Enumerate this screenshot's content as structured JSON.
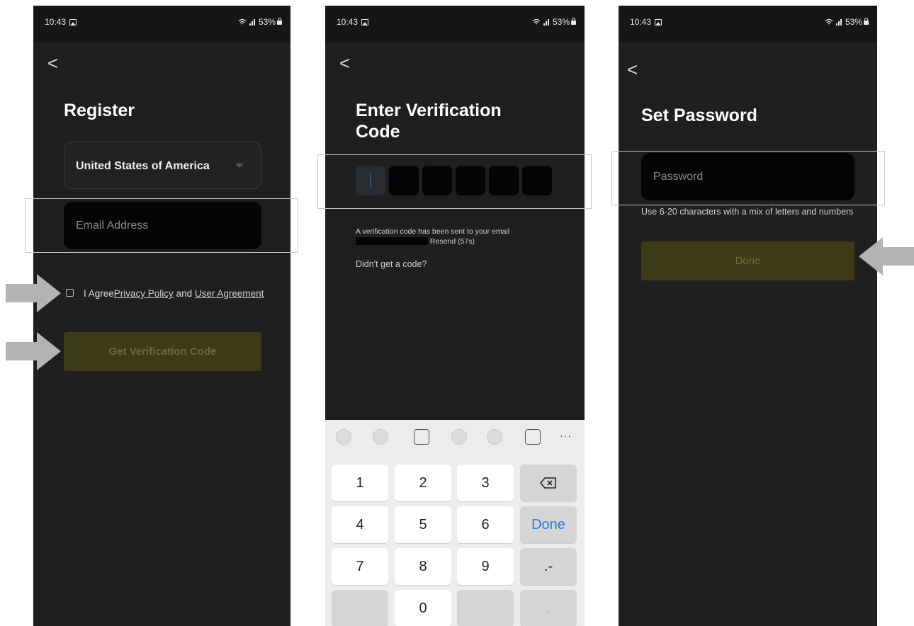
{
  "status": {
    "time": "10:43",
    "battery": "53%"
  },
  "screen1": {
    "back": "<",
    "title": "Register",
    "country": "United States of America",
    "email_placeholder": "Email Address",
    "agree_prefix": "I Agree",
    "privacy_link": "Privacy Policy",
    "agree_and": " and ",
    "user_agreement_link": "User Agreement",
    "button": "Get Verification Code"
  },
  "screen2": {
    "back": "<",
    "title_line1": "Enter Verification",
    "title_line2": "Code",
    "sent_text": "A verification code has been sent to your email",
    "resend": "Resend (57s)",
    "no_code": "Didn't get a code?",
    "keys": [
      "1",
      "2",
      "3",
      "4",
      "5",
      "6",
      "7",
      "8",
      "9",
      ".-",
      "0",
      ","
    ],
    "done_key": "Done",
    "more": "···"
  },
  "screen3": {
    "back": "<",
    "title": "Set Password",
    "password_placeholder": "Password",
    "hint": "Use 6-20 characters with a mix of letters and numbers",
    "button": "Done"
  },
  "colors": {
    "accent_button": "#3d3b18",
    "annotation": "#b3b3b3"
  },
  "icons": [
    "image-icon",
    "wifi-icon",
    "signal-icon",
    "lock-icon",
    "back-chevron-icon",
    "dropdown-caret-icon",
    "backspace-icon"
  ]
}
